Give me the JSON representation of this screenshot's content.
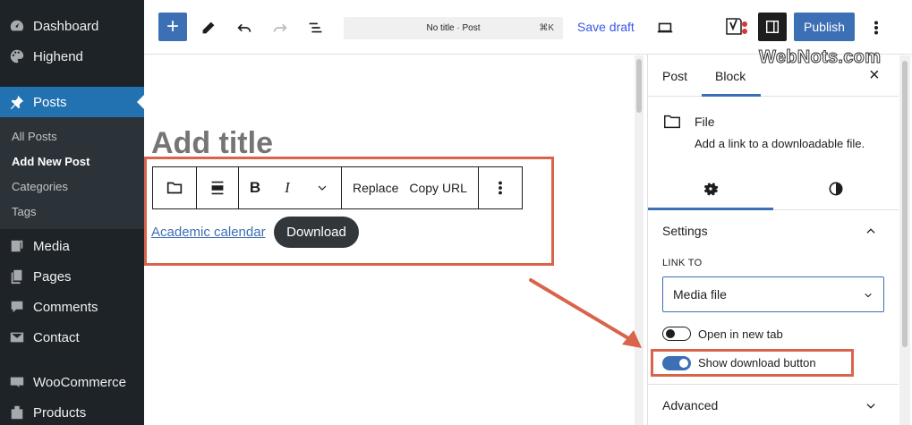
{
  "admin_menu": {
    "items": [
      {
        "label": "Dashboard",
        "icon": "dashboard-icon"
      },
      {
        "label": "Highend",
        "icon": "palette-icon"
      },
      {
        "label": "Posts",
        "icon": "pin-icon",
        "active": true
      },
      {
        "label": "Media",
        "icon": "media-icon"
      },
      {
        "label": "Pages",
        "icon": "pages-icon"
      },
      {
        "label": "Comments",
        "icon": "comments-icon"
      },
      {
        "label": "Contact",
        "icon": "mail-icon"
      },
      {
        "label": "WooCommerce",
        "icon": "woocommerce-icon"
      },
      {
        "label": "Products",
        "icon": "products-icon"
      }
    ],
    "submenu": [
      "All Posts",
      "Add New Post",
      "Categories",
      "Tags"
    ]
  },
  "toolbar": {
    "add_label": "+",
    "command_bar": "No title · Post",
    "shortcut": "⌘K",
    "save_draft": "Save draft",
    "publish": "Publish"
  },
  "editor": {
    "title_placeholder": "Add title",
    "block_toolbar": {
      "replace": "Replace",
      "copy_url": "Copy URL",
      "bold": "B",
      "italic": "I"
    },
    "file_link": "Academic calendar",
    "download_button": "Download"
  },
  "sidebar": {
    "tabs": [
      "Post",
      "Block"
    ],
    "active_tab": "Block",
    "close": "×",
    "block_name": "File",
    "block_description": "Add a link to a downloadable file.",
    "settings_heading": "Settings",
    "link_to_label": "LINK TO",
    "link_to_value": "Media file",
    "open_new_tab_label": "Open in new tab",
    "open_new_tab": false,
    "show_download_label": "Show download button",
    "show_download": true,
    "advanced_heading": "Advanced"
  },
  "watermark": "WebNots.com",
  "colors": {
    "accent": "#3d6fb4",
    "admin_bg": "#1d2327",
    "highlight": "#d9644c"
  }
}
